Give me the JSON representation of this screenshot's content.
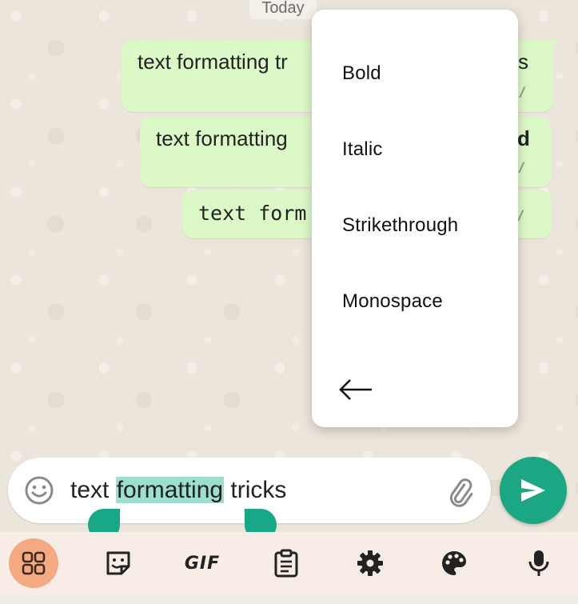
{
  "chat": {
    "date_chip": "Today",
    "messages": [
      {
        "visible_text": "text formatting tr",
        "end_char": "s"
      },
      {
        "visible_text": "text formatting",
        "end_char": "d"
      },
      {
        "visible_text": "text form",
        "end_char": ""
      }
    ]
  },
  "format_menu": {
    "items": [
      "Bold",
      "Italic",
      "Strikethrough",
      "Monospace"
    ],
    "back_icon": "arrow-left-icon"
  },
  "composer": {
    "text_before": "text ",
    "text_selected": "formatting",
    "text_after": " tricks",
    "emoji_icon": "emoji-icon",
    "attach_icon": "paperclip-icon",
    "send_icon": "send-icon"
  },
  "keyboard_toolbar": {
    "gif_label": "GIF",
    "icons": [
      "apps-grid-icon",
      "sticker-icon",
      "gif-icon",
      "clipboard-icon",
      "gear-icon",
      "palette-icon",
      "microphone-icon"
    ]
  },
  "colors": {
    "bubble": "#dcf8c6",
    "accent": "#1ba784",
    "selection": "#9ddfcf",
    "apps_button": "#f5a983"
  }
}
